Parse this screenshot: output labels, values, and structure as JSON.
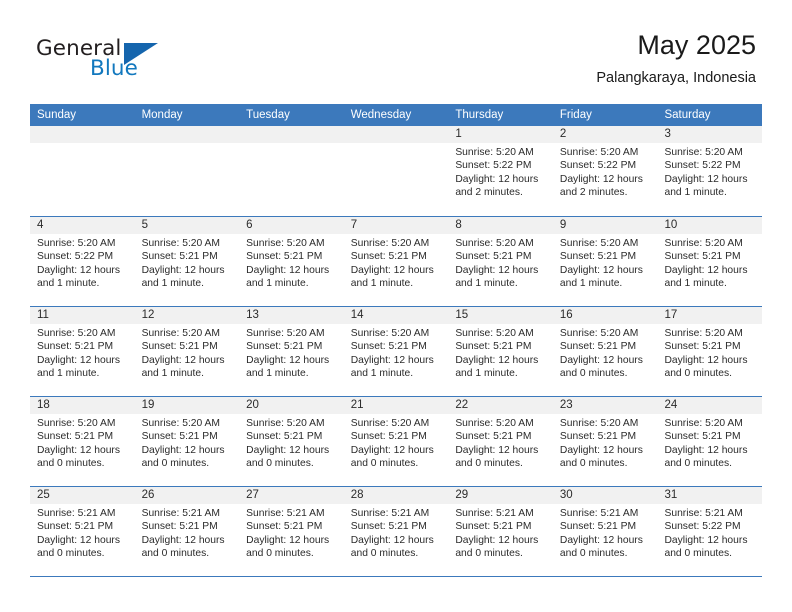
{
  "brand": {
    "name_part1": "General",
    "name_part2": "Blue",
    "triangle_icon": "triangle-icon",
    "accent_color": "#1565ad",
    "blue_text_color": "#1278be"
  },
  "header": {
    "title": "May 2025",
    "subtitle": "Palangkaraya, Indonesia"
  },
  "colors": {
    "header_blue": "#3c79bc",
    "day_band_gray": "#f1f1f1",
    "text": "#2b2b2b"
  },
  "weekdays": [
    "Sunday",
    "Monday",
    "Tuesday",
    "Wednesday",
    "Thursday",
    "Friday",
    "Saturday"
  ],
  "weeks": [
    [
      {
        "day": "",
        "empty": true,
        "sunrise": "",
        "sunset": "",
        "daylight_line1": "",
        "daylight_line2": ""
      },
      {
        "day": "",
        "empty": true,
        "sunrise": "",
        "sunset": "",
        "daylight_line1": "",
        "daylight_line2": ""
      },
      {
        "day": "",
        "empty": true,
        "sunrise": "",
        "sunset": "",
        "daylight_line1": "",
        "daylight_line2": ""
      },
      {
        "day": "",
        "empty": true,
        "sunrise": "",
        "sunset": "",
        "daylight_line1": "",
        "daylight_line2": ""
      },
      {
        "day": "1",
        "empty": false,
        "sunrise": "Sunrise: 5:20 AM",
        "sunset": "Sunset: 5:22 PM",
        "daylight_line1": "Daylight: 12 hours",
        "daylight_line2": "and 2 minutes."
      },
      {
        "day": "2",
        "empty": false,
        "sunrise": "Sunrise: 5:20 AM",
        "sunset": "Sunset: 5:22 PM",
        "daylight_line1": "Daylight: 12 hours",
        "daylight_line2": "and 2 minutes."
      },
      {
        "day": "3",
        "empty": false,
        "sunrise": "Sunrise: 5:20 AM",
        "sunset": "Sunset: 5:22 PM",
        "daylight_line1": "Daylight: 12 hours",
        "daylight_line2": "and 1 minute."
      }
    ],
    [
      {
        "day": "4",
        "empty": false,
        "sunrise": "Sunrise: 5:20 AM",
        "sunset": "Sunset: 5:22 PM",
        "daylight_line1": "Daylight: 12 hours",
        "daylight_line2": "and 1 minute."
      },
      {
        "day": "5",
        "empty": false,
        "sunrise": "Sunrise: 5:20 AM",
        "sunset": "Sunset: 5:21 PM",
        "daylight_line1": "Daylight: 12 hours",
        "daylight_line2": "and 1 minute."
      },
      {
        "day": "6",
        "empty": false,
        "sunrise": "Sunrise: 5:20 AM",
        "sunset": "Sunset: 5:21 PM",
        "daylight_line1": "Daylight: 12 hours",
        "daylight_line2": "and 1 minute."
      },
      {
        "day": "7",
        "empty": false,
        "sunrise": "Sunrise: 5:20 AM",
        "sunset": "Sunset: 5:21 PM",
        "daylight_line1": "Daylight: 12 hours",
        "daylight_line2": "and 1 minute."
      },
      {
        "day": "8",
        "empty": false,
        "sunrise": "Sunrise: 5:20 AM",
        "sunset": "Sunset: 5:21 PM",
        "daylight_line1": "Daylight: 12 hours",
        "daylight_line2": "and 1 minute."
      },
      {
        "day": "9",
        "empty": false,
        "sunrise": "Sunrise: 5:20 AM",
        "sunset": "Sunset: 5:21 PM",
        "daylight_line1": "Daylight: 12 hours",
        "daylight_line2": "and 1 minute."
      },
      {
        "day": "10",
        "empty": false,
        "sunrise": "Sunrise: 5:20 AM",
        "sunset": "Sunset: 5:21 PM",
        "daylight_line1": "Daylight: 12 hours",
        "daylight_line2": "and 1 minute."
      }
    ],
    [
      {
        "day": "11",
        "empty": false,
        "sunrise": "Sunrise: 5:20 AM",
        "sunset": "Sunset: 5:21 PM",
        "daylight_line1": "Daylight: 12 hours",
        "daylight_line2": "and 1 minute."
      },
      {
        "day": "12",
        "empty": false,
        "sunrise": "Sunrise: 5:20 AM",
        "sunset": "Sunset: 5:21 PM",
        "daylight_line1": "Daylight: 12 hours",
        "daylight_line2": "and 1 minute."
      },
      {
        "day": "13",
        "empty": false,
        "sunrise": "Sunrise: 5:20 AM",
        "sunset": "Sunset: 5:21 PM",
        "daylight_line1": "Daylight: 12 hours",
        "daylight_line2": "and 1 minute."
      },
      {
        "day": "14",
        "empty": false,
        "sunrise": "Sunrise: 5:20 AM",
        "sunset": "Sunset: 5:21 PM",
        "daylight_line1": "Daylight: 12 hours",
        "daylight_line2": "and 1 minute."
      },
      {
        "day": "15",
        "empty": false,
        "sunrise": "Sunrise: 5:20 AM",
        "sunset": "Sunset: 5:21 PM",
        "daylight_line1": "Daylight: 12 hours",
        "daylight_line2": "and 1 minute."
      },
      {
        "day": "16",
        "empty": false,
        "sunrise": "Sunrise: 5:20 AM",
        "sunset": "Sunset: 5:21 PM",
        "daylight_line1": "Daylight: 12 hours",
        "daylight_line2": "and 0 minutes."
      },
      {
        "day": "17",
        "empty": false,
        "sunrise": "Sunrise: 5:20 AM",
        "sunset": "Sunset: 5:21 PM",
        "daylight_line1": "Daylight: 12 hours",
        "daylight_line2": "and 0 minutes."
      }
    ],
    [
      {
        "day": "18",
        "empty": false,
        "sunrise": "Sunrise: 5:20 AM",
        "sunset": "Sunset: 5:21 PM",
        "daylight_line1": "Daylight: 12 hours",
        "daylight_line2": "and 0 minutes."
      },
      {
        "day": "19",
        "empty": false,
        "sunrise": "Sunrise: 5:20 AM",
        "sunset": "Sunset: 5:21 PM",
        "daylight_line1": "Daylight: 12 hours",
        "daylight_line2": "and 0 minutes."
      },
      {
        "day": "20",
        "empty": false,
        "sunrise": "Sunrise: 5:20 AM",
        "sunset": "Sunset: 5:21 PM",
        "daylight_line1": "Daylight: 12 hours",
        "daylight_line2": "and 0 minutes."
      },
      {
        "day": "21",
        "empty": false,
        "sunrise": "Sunrise: 5:20 AM",
        "sunset": "Sunset: 5:21 PM",
        "daylight_line1": "Daylight: 12 hours",
        "daylight_line2": "and 0 minutes."
      },
      {
        "day": "22",
        "empty": false,
        "sunrise": "Sunrise: 5:20 AM",
        "sunset": "Sunset: 5:21 PM",
        "daylight_line1": "Daylight: 12 hours",
        "daylight_line2": "and 0 minutes."
      },
      {
        "day": "23",
        "empty": false,
        "sunrise": "Sunrise: 5:20 AM",
        "sunset": "Sunset: 5:21 PM",
        "daylight_line1": "Daylight: 12 hours",
        "daylight_line2": "and 0 minutes."
      },
      {
        "day": "24",
        "empty": false,
        "sunrise": "Sunrise: 5:20 AM",
        "sunset": "Sunset: 5:21 PM",
        "daylight_line1": "Daylight: 12 hours",
        "daylight_line2": "and 0 minutes."
      }
    ],
    [
      {
        "day": "25",
        "empty": false,
        "sunrise": "Sunrise: 5:21 AM",
        "sunset": "Sunset: 5:21 PM",
        "daylight_line1": "Daylight: 12 hours",
        "daylight_line2": "and 0 minutes."
      },
      {
        "day": "26",
        "empty": false,
        "sunrise": "Sunrise: 5:21 AM",
        "sunset": "Sunset: 5:21 PM",
        "daylight_line1": "Daylight: 12 hours",
        "daylight_line2": "and 0 minutes."
      },
      {
        "day": "27",
        "empty": false,
        "sunrise": "Sunrise: 5:21 AM",
        "sunset": "Sunset: 5:21 PM",
        "daylight_line1": "Daylight: 12 hours",
        "daylight_line2": "and 0 minutes."
      },
      {
        "day": "28",
        "empty": false,
        "sunrise": "Sunrise: 5:21 AM",
        "sunset": "Sunset: 5:21 PM",
        "daylight_line1": "Daylight: 12 hours",
        "daylight_line2": "and 0 minutes."
      },
      {
        "day": "29",
        "empty": false,
        "sunrise": "Sunrise: 5:21 AM",
        "sunset": "Sunset: 5:21 PM",
        "daylight_line1": "Daylight: 12 hours",
        "daylight_line2": "and 0 minutes."
      },
      {
        "day": "30",
        "empty": false,
        "sunrise": "Sunrise: 5:21 AM",
        "sunset": "Sunset: 5:21 PM",
        "daylight_line1": "Daylight: 12 hours",
        "daylight_line2": "and 0 minutes."
      },
      {
        "day": "31",
        "empty": false,
        "sunrise": "Sunrise: 5:21 AM",
        "sunset": "Sunset: 5:22 PM",
        "daylight_line1": "Daylight: 12 hours",
        "daylight_line2": "and 0 minutes."
      }
    ]
  ]
}
